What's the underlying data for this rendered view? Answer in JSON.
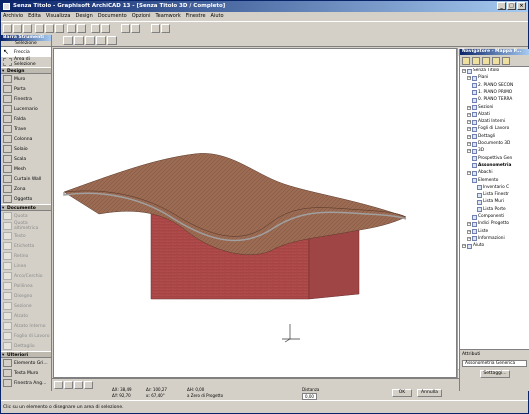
{
  "window": {
    "title": "Senza Titolo - Graphisoft ArchiCAD 13 - [Senza Titolo 3D / Completo]",
    "buttons": [
      "_",
      "□",
      "×"
    ]
  },
  "menu": [
    "Archivio",
    "Edita",
    "Visualizza",
    "Design",
    "Documento",
    "Opzioni",
    "Teamwork",
    "Finestre",
    "Aiuto"
  ],
  "toolbox": {
    "title": "Barra Strumenti",
    "selection_label": "Selezione",
    "arrow_label": "Freccia",
    "marquee_label": "Area di Selezione",
    "design_header": "Design",
    "design_tools": [
      "Muro",
      "Porta",
      "Finestra",
      "Lucernario",
      "Falda",
      "Trave",
      "Colonna",
      "Solaio",
      "Scala",
      "Mesh",
      "Curtain Wall",
      "Zona",
      "Oggetto"
    ],
    "documento_header": "Documento",
    "documento_tools": [
      "Quota",
      "Quota altimetrica",
      "Testo",
      "Etichetta",
      "Retino",
      "Linea",
      "Arco/Cerchio",
      "Polilinea",
      "Disegno",
      "Sezione",
      "Alzato",
      "Alzato Interno",
      "Foglio di Lavoro",
      "Dettaglio"
    ],
    "ulteriori_header": "Ulteriori",
    "ulteriori_tools": [
      "Elemento Gri...",
      "Testa Muro",
      "Finestra Ang..."
    ]
  },
  "navigator": {
    "title": "Navigatore - Mappa P...",
    "tree": [
      {
        "label": "Senza Titolo",
        "level": 0
      },
      {
        "label": "Piani",
        "level": 1
      },
      {
        "label": "2. PIANO SECON",
        "level": 2
      },
      {
        "label": "1. PIANO PRIMO",
        "level": 2
      },
      {
        "label": "0. PIANO TERRA",
        "level": 2
      },
      {
        "label": "Sezioni",
        "level": 1
      },
      {
        "label": "Alzati",
        "level": 1
      },
      {
        "label": "Alzati Interni",
        "level": 1
      },
      {
        "label": "Fogli di Lavoro",
        "level": 1
      },
      {
        "label": "Dettagli",
        "level": 1
      },
      {
        "label": "Documento 3D",
        "level": 1
      },
      {
        "label": "3D",
        "level": 1
      },
      {
        "label": "Prospettiva Gen",
        "level": 2
      },
      {
        "label": "Assonometria",
        "level": 2
      },
      {
        "label": "Abachi",
        "level": 1
      },
      {
        "label": "Elemento",
        "level": 2
      },
      {
        "label": "Inventario C",
        "level": 3
      },
      {
        "label": "Lista Finestr",
        "level": 3
      },
      {
        "label": "Lista Muri",
        "level": 3
      },
      {
        "label": "Lista Porte",
        "level": 3
      },
      {
        "label": "Componenti",
        "level": 2
      },
      {
        "label": "Indici Progetto",
        "level": 1
      },
      {
        "label": "Liste",
        "level": 1
      },
      {
        "label": "Informazioni",
        "level": 1
      },
      {
        "label": "Aiuto",
        "level": 0
      }
    ],
    "attributes_label": "Attributi",
    "current_view": "Assonometria Generica",
    "settings_button": "Settaggi..."
  },
  "coords": {
    "dx": "ΔX: 38,49",
    "dy": "ΔY: 92,70",
    "dr": "Δr: 100,27",
    "angle": "α: 67,40°",
    "dz": "ΔH: 0,00",
    "ref": "a Zero di Progetto",
    "z2": "ΔH: 0,00",
    "dist_label": "Distanza",
    "dist_value": "0,00",
    "ok": "OK",
    "cancel": "Annulla"
  },
  "status": "Clic su un elemento o disegnare un area di selezione.",
  "colors": {
    "titlebar": "#0a246a",
    "roof": "#9a6a52",
    "wall": "#b24e4e"
  }
}
